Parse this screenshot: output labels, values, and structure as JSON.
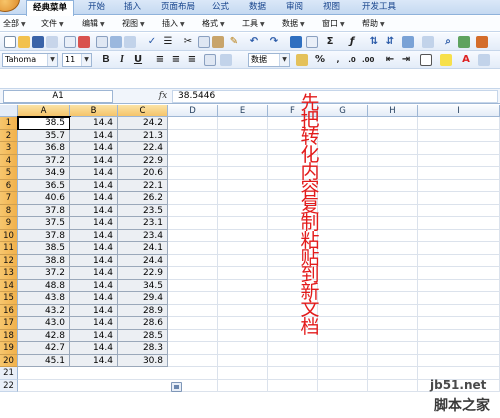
{
  "ribbon_tabs": [
    "经典菜单",
    "开始",
    "插入",
    "页面布局",
    "公式",
    "数据",
    "审阅",
    "视图",
    "开发工具"
  ],
  "menu_items": [
    "全部",
    "文件",
    "编辑",
    "视图",
    "插入",
    "格式",
    "工具",
    "数据",
    "窗口",
    "帮助"
  ],
  "toolbar": {
    "font_name": "Tahoma",
    "font_size": "11",
    "number_format": "数据",
    "bold": "B",
    "italic": "I",
    "underline": "U",
    "sum": "Σ",
    "percent": "%"
  },
  "formula_bar": {
    "name_box": "A1",
    "fx_label": "fx",
    "value": "38.5446"
  },
  "columns": [
    "A",
    "B",
    "C",
    "D",
    "E",
    "F",
    "G",
    "H",
    "I"
  ],
  "rows": [
    "1",
    "2",
    "3",
    "4",
    "5",
    "6",
    "7",
    "8",
    "9",
    "10",
    "11",
    "12",
    "13",
    "14",
    "15",
    "16",
    "17",
    "18",
    "19",
    "20",
    "21",
    "22"
  ],
  "sheet_data": [
    [
      "38.5",
      "14.4",
      "24.2"
    ],
    [
      "35.7",
      "14.4",
      "21.3"
    ],
    [
      "36.8",
      "14.4",
      "22.4"
    ],
    [
      "37.2",
      "14.4",
      "22.9"
    ],
    [
      "34.9",
      "14.4",
      "20.6"
    ],
    [
      "36.5",
      "14.4",
      "22.1"
    ],
    [
      "40.6",
      "14.4",
      "26.2"
    ],
    [
      "37.8",
      "14.4",
      "23.5"
    ],
    [
      "37.5",
      "14.4",
      "23.1"
    ],
    [
      "37.8",
      "14.4",
      "23.4"
    ],
    [
      "38.5",
      "14.4",
      "24.1"
    ],
    [
      "38.8",
      "14.4",
      "24.4"
    ],
    [
      "37.2",
      "14.4",
      "22.9"
    ],
    [
      "48.8",
      "14.4",
      "34.5"
    ],
    [
      "43.8",
      "14.4",
      "29.4"
    ],
    [
      "43.2",
      "14.4",
      "28.9"
    ],
    [
      "43.0",
      "14.4",
      "28.6"
    ],
    [
      "42.8",
      "14.4",
      "28.5"
    ],
    [
      "42.7",
      "14.4",
      "28.3"
    ],
    [
      "45.1",
      "14.4",
      "30.8"
    ]
  ],
  "annotation": "先把转化内容复制粘贴到新文档",
  "watermark": {
    "site": "jb51.net",
    "name": "脚本之家"
  },
  "colors": {
    "annotation": "#e31b1b",
    "selection_header": "#f5c46a",
    "ribbon": "#c5d9f1"
  }
}
